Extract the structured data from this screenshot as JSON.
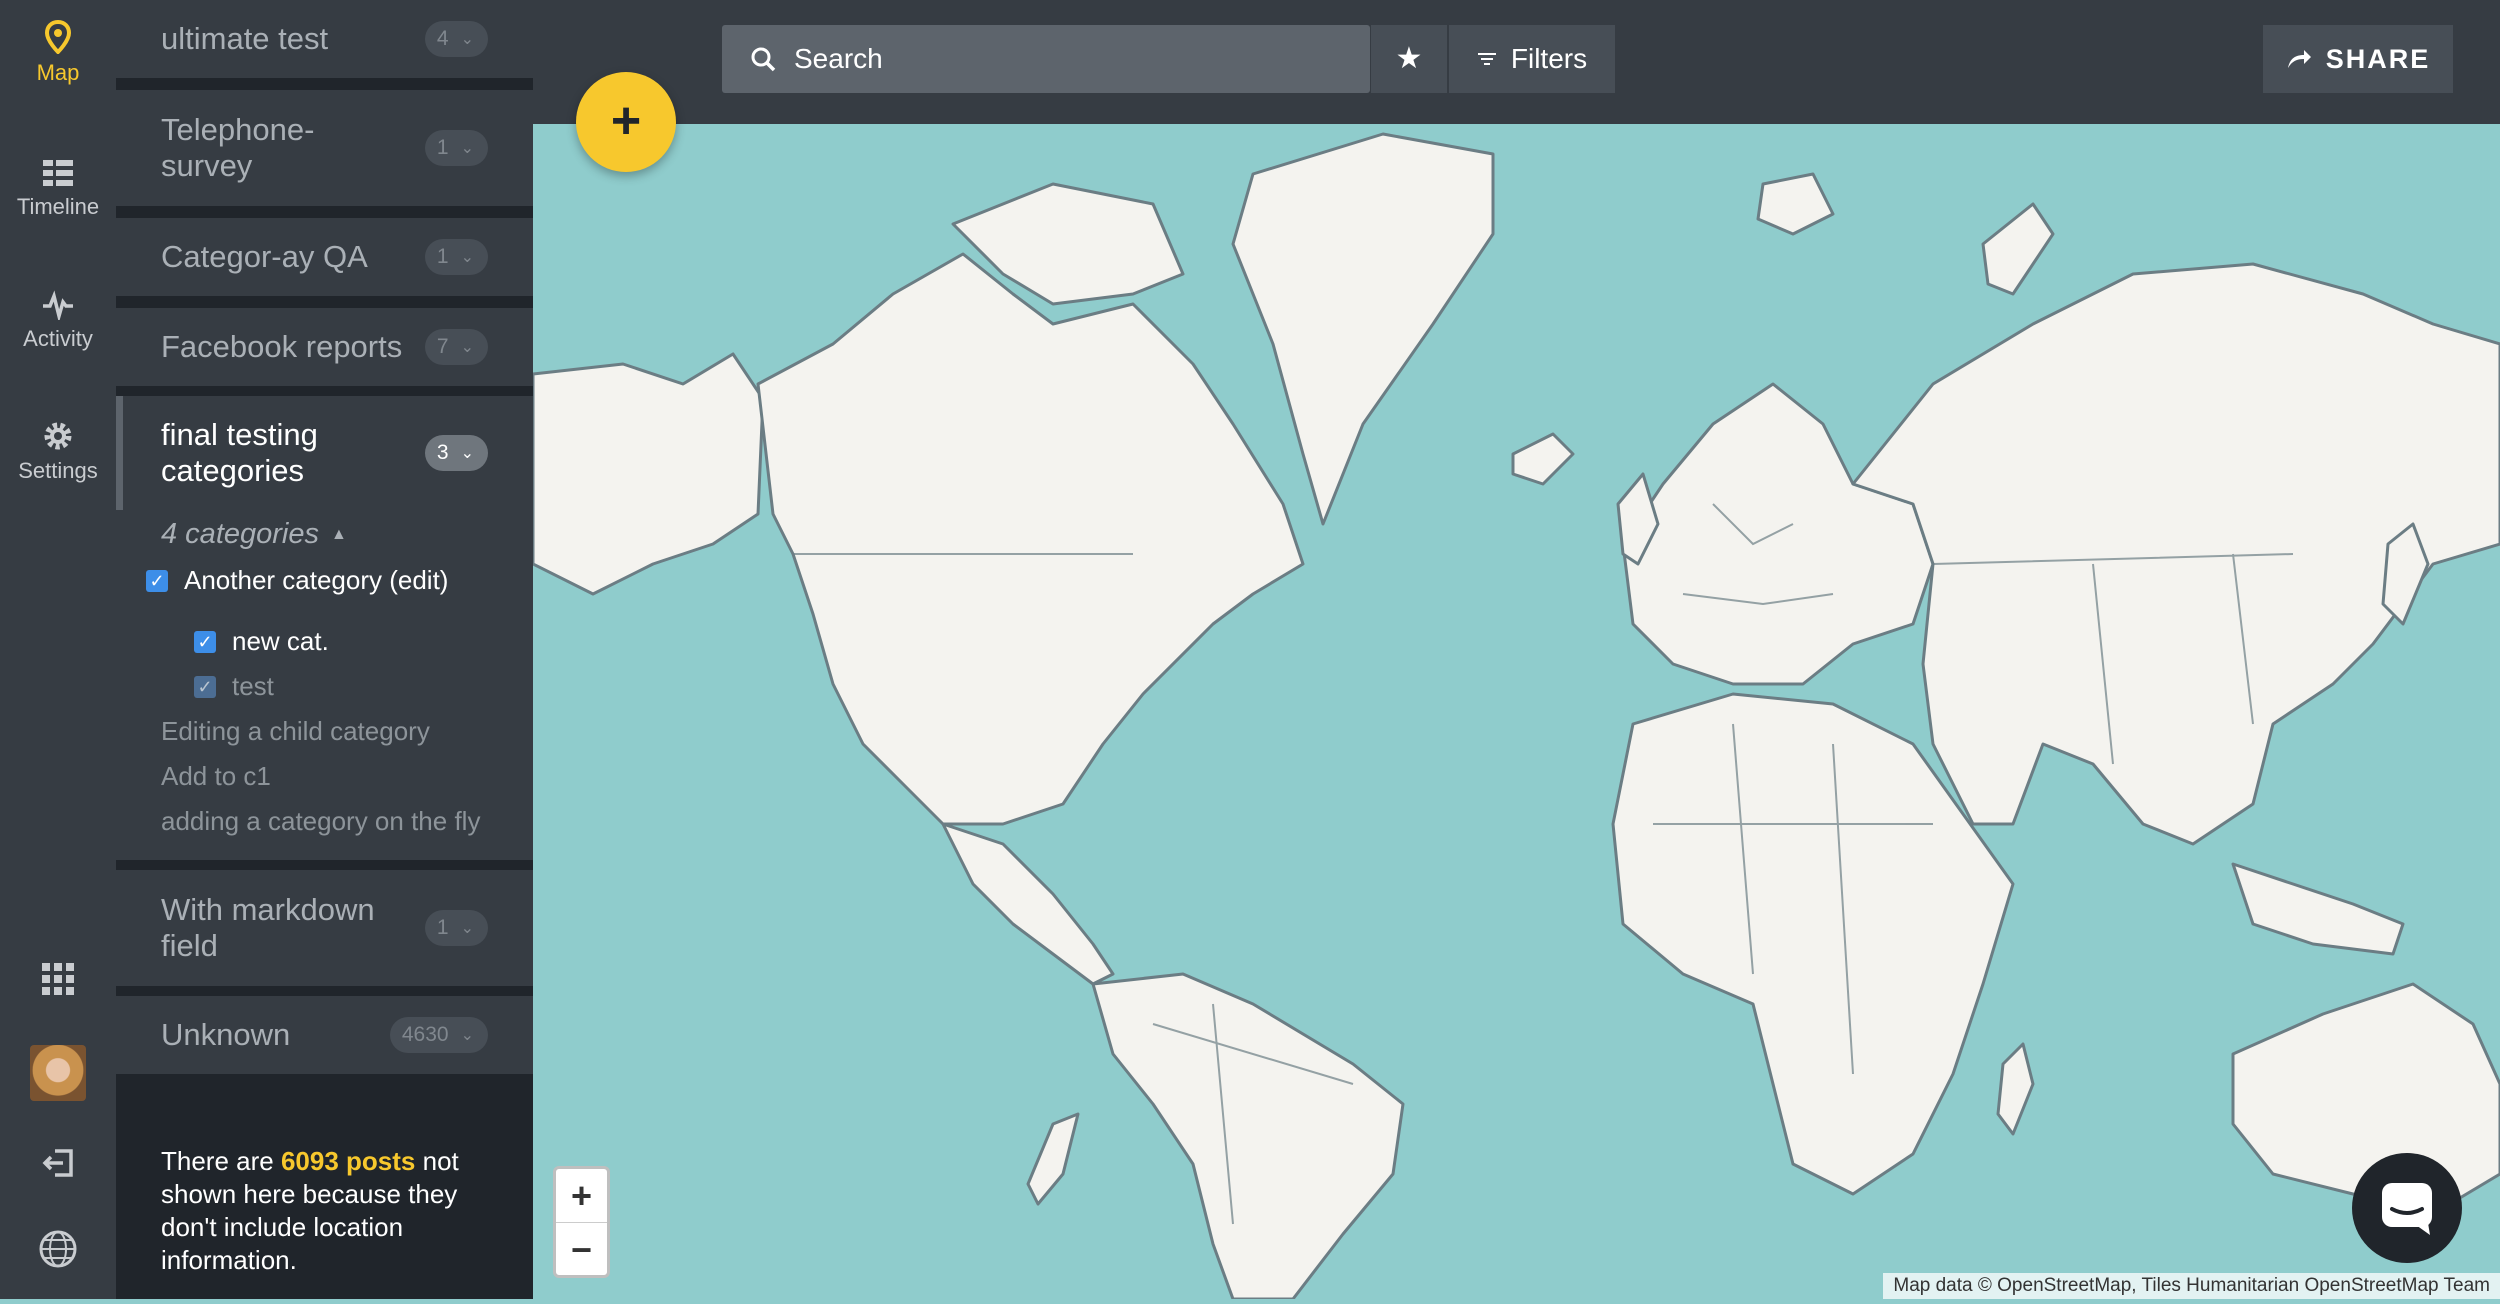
{
  "nav": {
    "map": "Map",
    "timeline": "Timeline",
    "activity": "Activity",
    "settings": "Settings"
  },
  "sidebar": {
    "surveys": [
      {
        "name": "ultimate test",
        "count": "4"
      },
      {
        "name": "Telephone-survey",
        "count": "1"
      },
      {
        "name": "Categor-ay QA",
        "count": "1"
      },
      {
        "name": "Facebook reports",
        "count": "7"
      },
      {
        "name": "final testing categories",
        "count": "3"
      },
      {
        "name": "With markdown field",
        "count": "1"
      },
      {
        "name": "Unknown",
        "count": "4630"
      }
    ],
    "categories": {
      "header": "4 categories",
      "items": [
        {
          "label": "Another category (edit)",
          "checked": true
        },
        {
          "label": "new cat.",
          "checked": true
        },
        {
          "label": "test",
          "checked": true
        },
        {
          "label": "Editing a child category",
          "checked": false
        },
        {
          "label": "Add to c1",
          "checked": false
        },
        {
          "label": "adding a category on the fly",
          "checked": false
        }
      ]
    },
    "unmapped": {
      "prefix": "There are",
      "highlight": "6093 posts",
      "suffix": "not shown here because they don't include location information."
    }
  },
  "topbar": {
    "search_placeholder": "Search",
    "filters": "Filters",
    "share": "SHARE"
  },
  "map": {
    "add": "+",
    "zoom_in": "+",
    "zoom_out": "−",
    "attribution": "Map data © OpenStreetMap, Tiles Humanitarian OpenStreetMap Team",
    "colors": {
      "water": "#8fcccc",
      "land": "#f4f3ef",
      "border": "#6b7d84"
    }
  }
}
